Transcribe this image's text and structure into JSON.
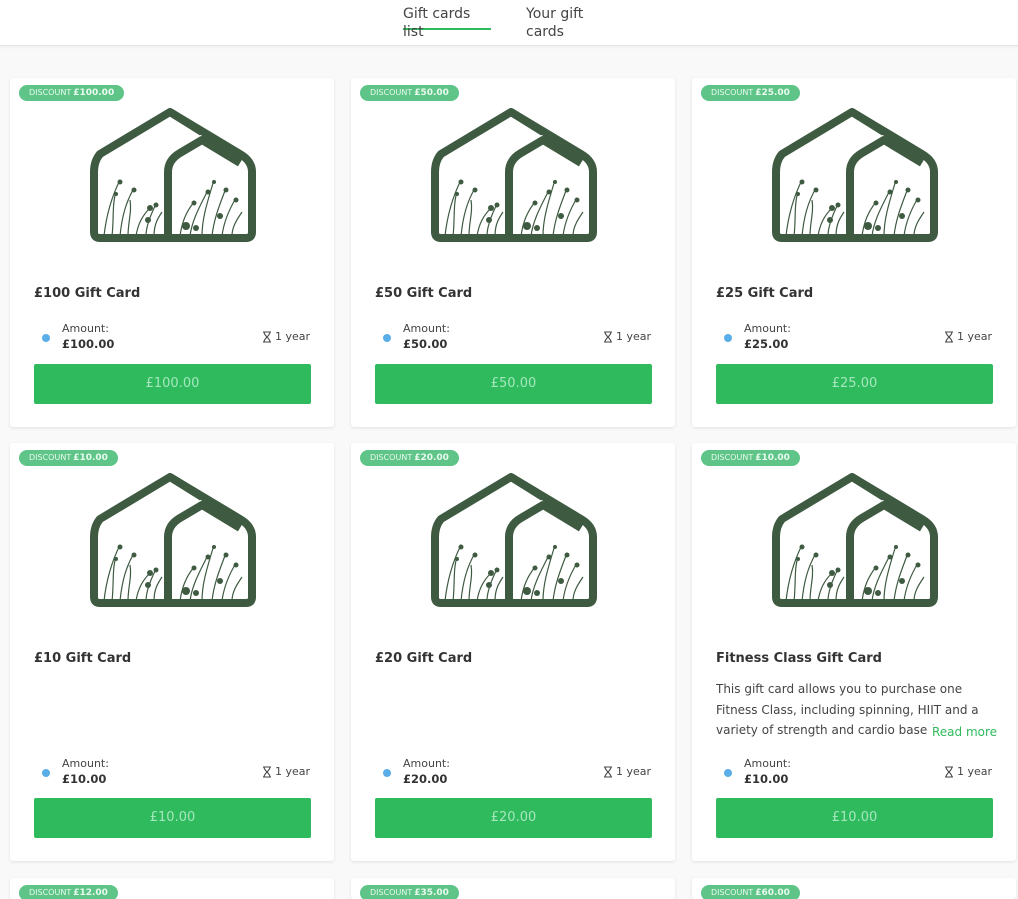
{
  "tabs": [
    {
      "label": "Gift cards list",
      "active": true
    },
    {
      "label": "Your gift cards",
      "active": false
    }
  ],
  "labels": {
    "discount": "DISCOUNT",
    "amount": "Amount:",
    "read_more": "Read more"
  },
  "icons": {
    "duration": "hourglass-icon",
    "amount": "dot-icon",
    "logo": "greenhouse-logo-icon"
  },
  "colors": {
    "accent": "#2fba5d",
    "badge": "#5ec487",
    "logo": "#3e5a41",
    "dot": "#5aaee8"
  },
  "cards": [
    {
      "discount": "£100.00",
      "title": "£100 Gift Card",
      "amount": "£100.00",
      "duration": "1 year",
      "price": "£100.00"
    },
    {
      "discount": "£50.00",
      "title": "£50 Gift Card",
      "amount": "£50.00",
      "duration": "1 year",
      "price": "£50.00"
    },
    {
      "discount": "£25.00",
      "title": "£25 Gift Card",
      "amount": "£25.00",
      "duration": "1 year",
      "price": "£25.00"
    },
    {
      "discount": "£10.00",
      "title": "£10 Gift Card",
      "amount": "£10.00",
      "duration": "1 year",
      "price": "£10.00"
    },
    {
      "discount": "£20.00",
      "title": "£20 Gift Card",
      "amount": "£20.00",
      "duration": "1 year",
      "price": "£20.00"
    },
    {
      "discount": "£10.00",
      "title": "Fitness Class Gift Card",
      "description": "This gift card allows you to purchase one Fitness Class, including spinning, HIIT and a variety of strength and cardio based training.",
      "amount": "£10.00",
      "duration": "1 year",
      "price": "£10.00"
    },
    {
      "discount": "£12.00"
    },
    {
      "discount": "£35.00"
    },
    {
      "discount": "£60.00"
    }
  ]
}
